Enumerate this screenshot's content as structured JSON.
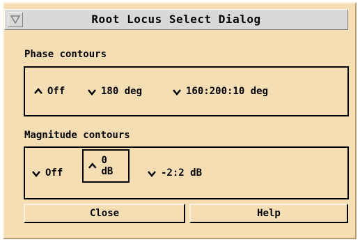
{
  "dialog": {
    "title": "Root Locus Select Dialog"
  },
  "phase": {
    "label": "Phase contours",
    "options": [
      {
        "label": "Off",
        "selected": true
      },
      {
        "label": "180 deg",
        "selected": false
      },
      {
        "label": "160:200:10 deg",
        "selected": false
      }
    ]
  },
  "magnitude": {
    "label": "Magnitude contours",
    "options": [
      {
        "label": "Off",
        "selected": false
      },
      {
        "label": "0 dB",
        "selected": true
      },
      {
        "label": "-2:2 dB",
        "selected": false
      }
    ]
  },
  "buttons": {
    "close_label": "Close",
    "help_label": "Help"
  },
  "colors": {
    "background": "#f5deb3",
    "titlebar": "#d9d9d9"
  }
}
